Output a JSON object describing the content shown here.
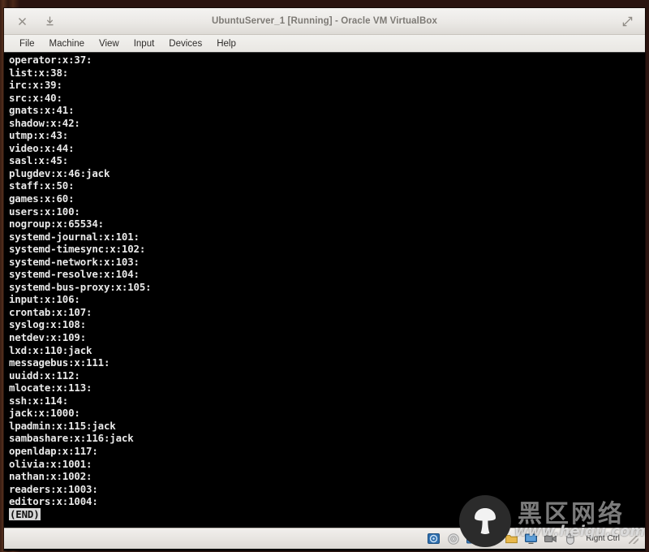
{
  "window": {
    "title": "UbuntuServer_1 [Running] - Oracle VM VirtualBox",
    "close_label": "×",
    "minimize_label": "⤓",
    "fullscreen_label": "fullscreen"
  },
  "menubar": {
    "items": [
      {
        "label": "File"
      },
      {
        "label": "Machine"
      },
      {
        "label": "View"
      },
      {
        "label": "Input"
      },
      {
        "label": "Devices"
      },
      {
        "label": "Help"
      }
    ]
  },
  "terminal": {
    "lines": [
      "operator:x:37:",
      "list:x:38:",
      "irc:x:39:",
      "src:x:40:",
      "gnats:x:41:",
      "shadow:x:42:",
      "utmp:x:43:",
      "video:x:44:",
      "sasl:x:45:",
      "plugdev:x:46:jack",
      "staff:x:50:",
      "games:x:60:",
      "users:x:100:",
      "nogroup:x:65534:",
      "systemd-journal:x:101:",
      "systemd-timesync:x:102:",
      "systemd-network:x:103:",
      "systemd-resolve:x:104:",
      "systemd-bus-proxy:x:105:",
      "input:x:106:",
      "crontab:x:107:",
      "syslog:x:108:",
      "netdev:x:109:",
      "lxd:x:110:jack",
      "messagebus:x:111:",
      "uuidd:x:112:",
      "mlocate:x:113:",
      "ssh:x:114:",
      "jack:x:1000:",
      "lpadmin:x:115:jack",
      "sambashare:x:116:jack",
      "openldap:x:117:",
      "olivia:x:1001:",
      "nathan:x:1002:",
      "readers:x:1003:",
      "editors:x:1004:"
    ],
    "pager_marker": "(END)",
    "background_color": "#000000",
    "text_color": "#e9e9e9"
  },
  "statusbar": {
    "icons": [
      {
        "name": "hard-disk-icon"
      },
      {
        "name": "optical-disk-icon"
      },
      {
        "name": "network-adapter-icon"
      },
      {
        "name": "usb-icon"
      },
      {
        "name": "shared-folder-icon"
      },
      {
        "name": "display-icon"
      },
      {
        "name": "video-capture-icon"
      },
      {
        "name": "mouse-integration-icon"
      }
    ],
    "host_key": "Right Ctrl"
  },
  "watermark": {
    "chinese_text": "黑区网络",
    "url": "www.heiqu.com",
    "logo_name": "mushroom-logo"
  }
}
